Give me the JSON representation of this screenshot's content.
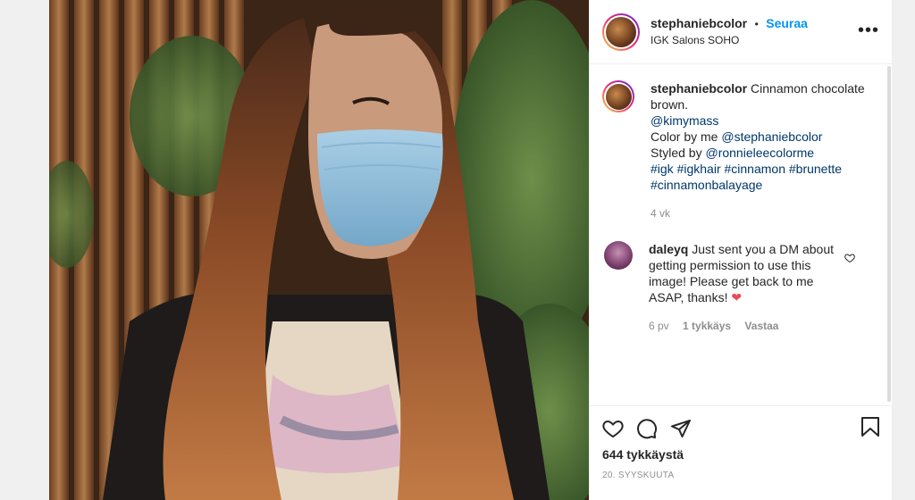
{
  "post": {
    "username": "stephaniebcolor",
    "separator": "•",
    "follow_label": "Seuraa",
    "location": "IGK Salons SOHO",
    "more_label": "•••"
  },
  "caption": {
    "username": "stephaniebcolor",
    "text_first": "Cinnamon chocolate brown.",
    "mention1": "@kimymass",
    "line3_prefix": "Color by me ",
    "mention2": "@stephaniebcolor",
    "line4_prefix": "Styled by ",
    "mention3": "@ronnieleecolorme",
    "hashtags1": "#igk #igkhair #cinnamon #brunette",
    "hashtags2": "#cinnamonbalayage",
    "time": "4 vk"
  },
  "comment": {
    "username": "daleyq",
    "text": "Just sent you a DM about getting permission to use this image! Please get back to me ASAP, thanks!",
    "heart": "❤",
    "time": "6 pv",
    "likes": "1 tykkäys",
    "reply": "Vastaa"
  },
  "actions": {
    "likes_count": "644 tykkäystä",
    "date": "20. SYYSKUUTA"
  },
  "icons": [
    "heart-icon",
    "comment-icon",
    "share-icon",
    "bookmark-icon",
    "more-icon"
  ],
  "colors": {
    "link": "#00376b",
    "follow": "#0095f6",
    "heart": "#ed4956",
    "muted": "#8e8e8e"
  }
}
